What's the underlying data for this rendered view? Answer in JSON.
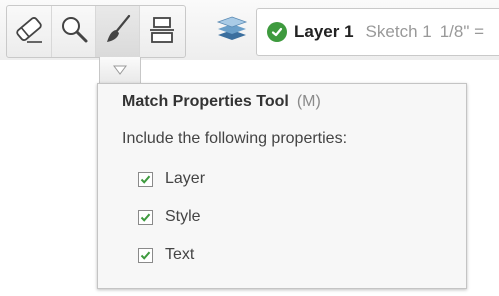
{
  "toolbar": {
    "tools": [
      {
        "icon": "eraser-icon",
        "label": ""
      },
      {
        "icon": "zoom-icon",
        "label": ""
      },
      {
        "icon": "paintbrush-icon",
        "label": ""
      },
      {
        "icon": "align-icon",
        "label": ""
      }
    ],
    "layers_icon": "layers-stack-icon",
    "layer_combo": {
      "status_icon": "check-circle-icon",
      "layer": "Layer 1",
      "sketch": "Sketch 1",
      "scale": "1/8\" ="
    }
  },
  "tooltip": {
    "title": "Match Properties Tool",
    "shortcut": "(M)",
    "description": "Include the following properties:",
    "options": [
      {
        "label": "Layer",
        "checked": true
      },
      {
        "label": "Style",
        "checked": true
      },
      {
        "label": "Text",
        "checked": true
      }
    ]
  },
  "colors": {
    "check_green": "#3e9a3e",
    "accent_dark": "#222222"
  }
}
